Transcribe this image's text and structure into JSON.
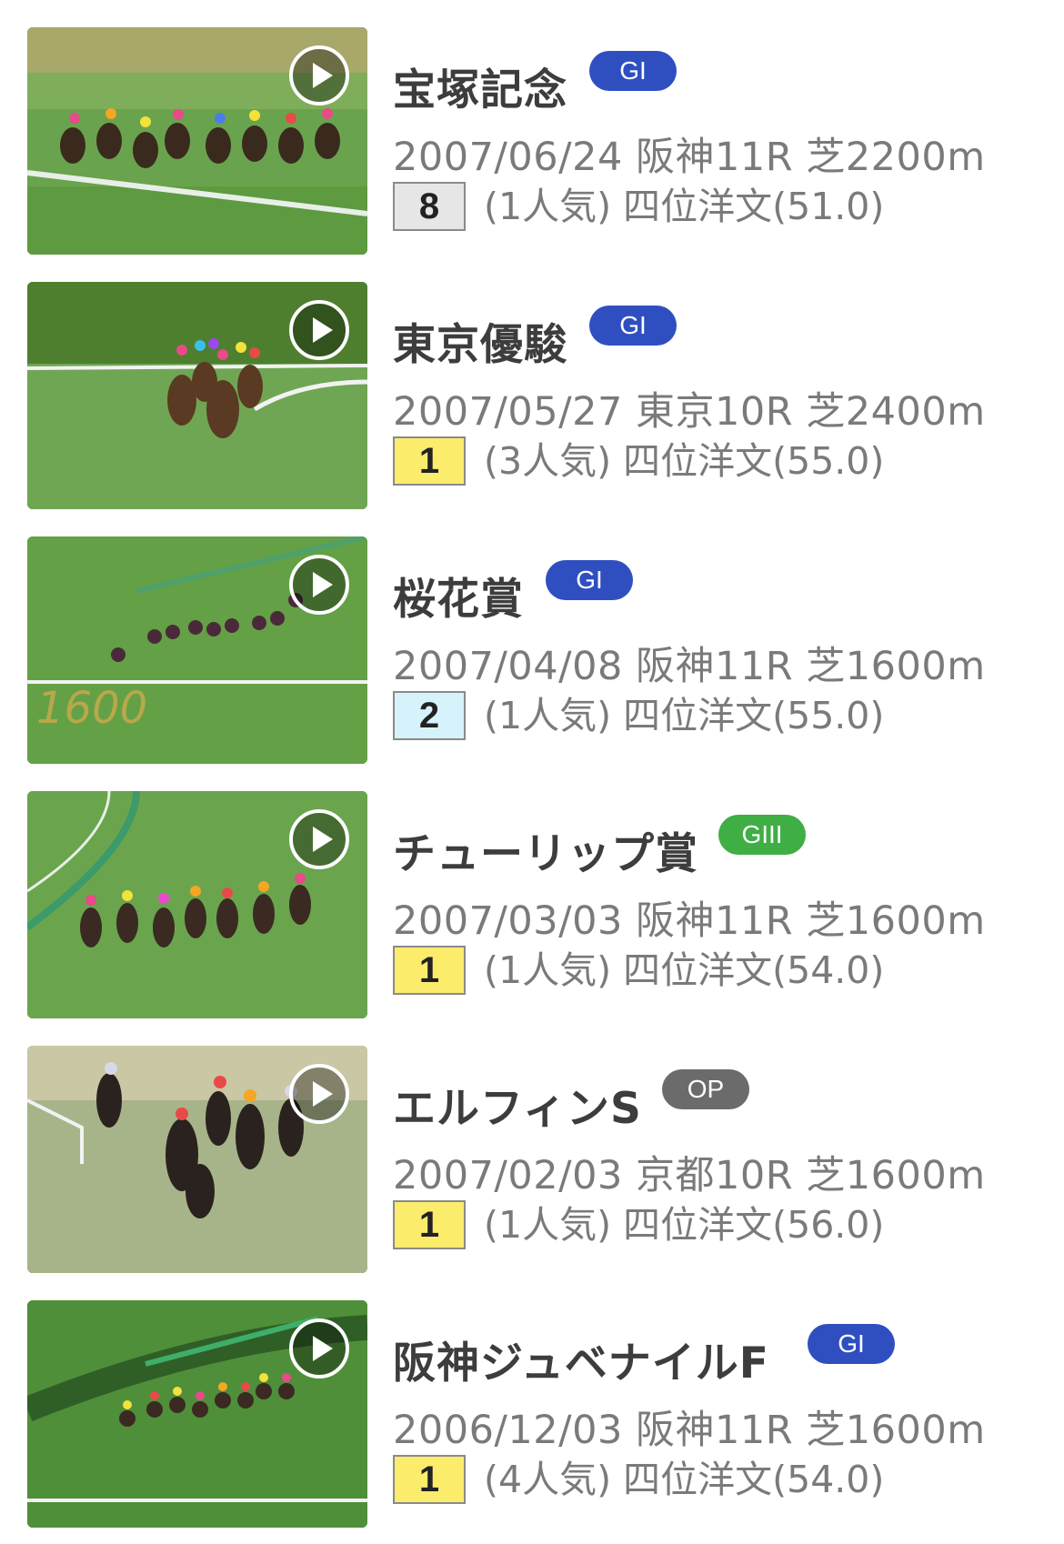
{
  "colors": {
    "grade_GI": "#2f4fc1",
    "grade_GIII": "#3fae45",
    "grade_OP": "#6b6b6b",
    "finish_1": "#fbec6c",
    "finish_2": "#d6f3fb",
    "finish_other": "#e6e6e6"
  },
  "races": [
    {
      "name": "宝塚記念",
      "grade": "GI",
      "grade_color": "#2f4fc1",
      "info": "2007/06/24 阪神11R 芝2200m",
      "finish": "8",
      "finish_bg": "#e6e6e6",
      "detail": "(1人気) 四位洋文(51.0)",
      "thumb_icon": "play-icon"
    },
    {
      "name": "東京優駿",
      "grade": "GI",
      "grade_color": "#2f4fc1",
      "info": "2007/05/27 東京10R 芝2400m",
      "finish": "1",
      "finish_bg": "#fbec6c",
      "detail": "(3人気) 四位洋文(55.0)",
      "thumb_icon": "play-icon"
    },
    {
      "name": "桜花賞",
      "grade": "GI",
      "grade_color": "#2f4fc1",
      "info": "2007/04/08 阪神11R 芝1600m",
      "finish": "2",
      "finish_bg": "#d6f3fb",
      "detail": "(1人気) 四位洋文(55.0)",
      "thumb_icon": "play-icon"
    },
    {
      "name": "チューリップ賞",
      "grade": "GIII",
      "grade_color": "#3fae45",
      "info": "2007/03/03 阪神11R 芝1600m",
      "finish": "1",
      "finish_bg": "#fbec6c",
      "detail": "(1人気) 四位洋文(54.0)",
      "thumb_icon": "play-icon"
    },
    {
      "name": "エルフィンS",
      "grade": "OP",
      "grade_color": "#6b6b6b",
      "info": "2007/02/03 京都10R 芝1600m",
      "finish": "1",
      "finish_bg": "#fbec6c",
      "detail": "(1人気) 四位洋文(56.0)",
      "thumb_icon": "play-icon"
    },
    {
      "name": "阪神ジュベナイルF",
      "grade": "GI",
      "grade_color": "#2f4fc1",
      "info": "2006/12/03 阪神11R 芝1600m",
      "finish": "1",
      "finish_bg": "#fbec6c",
      "detail": "(4人気) 四位洋文(54.0)",
      "thumb_icon": "play-icon"
    }
  ]
}
